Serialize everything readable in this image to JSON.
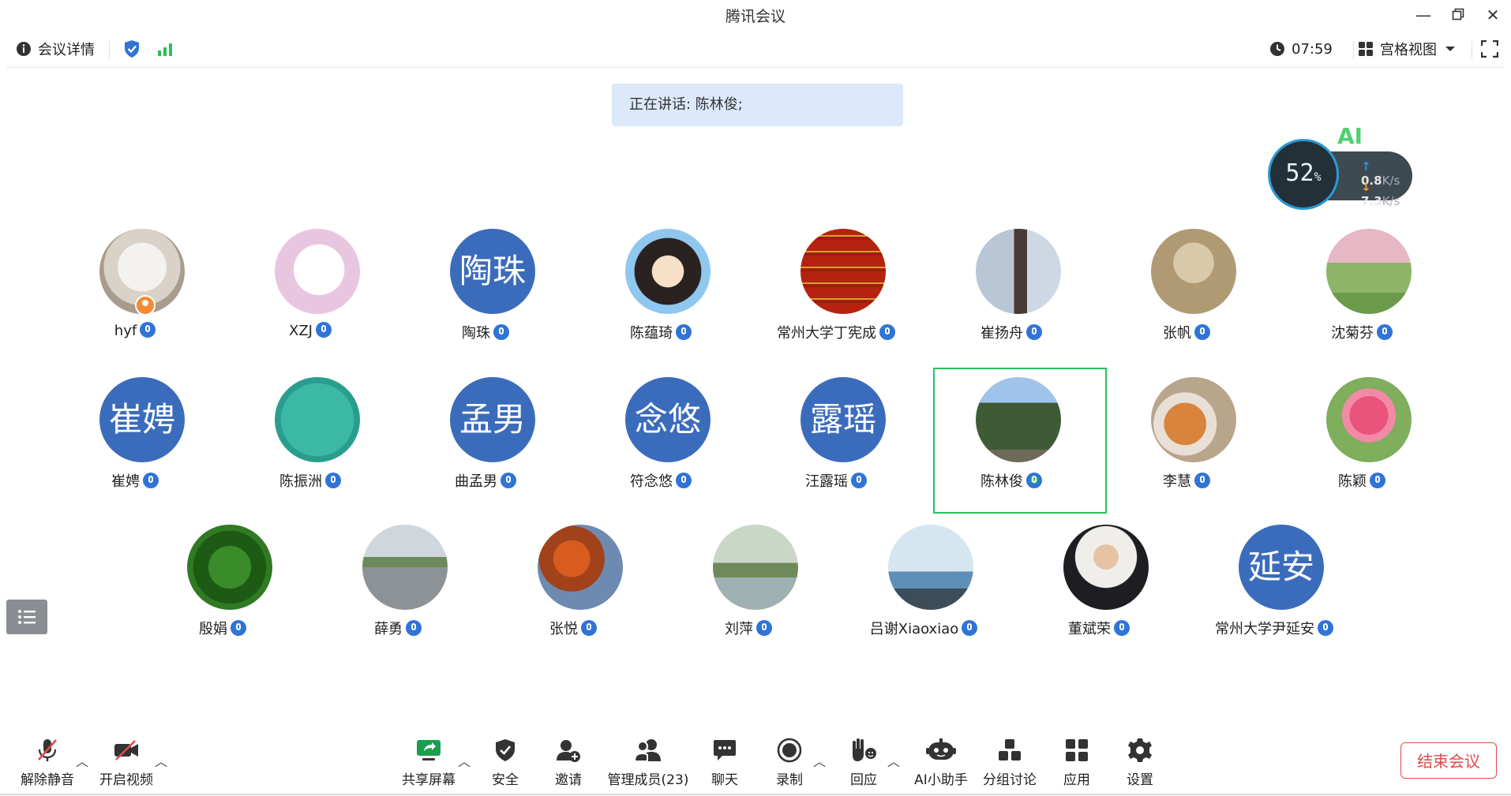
{
  "window": {
    "title": "腾讯会议"
  },
  "topbar": {
    "meeting_info": "会议详情",
    "timer": "07:59",
    "view_mode": "宫格视图"
  },
  "speaking": "正在讲话: 陈林俊;",
  "network": {
    "ai_label": "AI",
    "cpu_percent": "52",
    "percent_sign": "%",
    "up_rate": "0.8",
    "down_rate": "7.3",
    "rate_unit": "K/s"
  },
  "participants": [
    {
      "name": "hyf",
      "avatar_text": "",
      "photo": "cat"
    },
    {
      "name": "XZJ",
      "avatar_text": "",
      "photo": "cartoon-bear"
    },
    {
      "name": "陶珠",
      "avatar_text": "陶珠"
    },
    {
      "name": "陈蕴琦",
      "avatar_text": "",
      "photo": "cartoon-girl"
    },
    {
      "name": "常州大学丁宪成",
      "avatar_text": "",
      "photo": "red-calligraphy"
    },
    {
      "name": "崔扬舟",
      "avatar_text": "",
      "photo": "person-window"
    },
    {
      "name": "张帆",
      "avatar_text": "",
      "photo": "ink-portrait"
    },
    {
      "name": "沈菊芬",
      "avatar_text": "",
      "photo": "blossom-park"
    },
    {
      "name": "崔娉",
      "avatar_text": "崔娉"
    },
    {
      "name": "陈振洲",
      "avatar_text": "",
      "photo": "flower-card"
    },
    {
      "name": "曲孟男",
      "avatar_text": "孟男"
    },
    {
      "name": "符念悠",
      "avatar_text": "念悠"
    },
    {
      "name": "汪露瑶",
      "avatar_text": "露瑶"
    },
    {
      "name": "陈林俊",
      "avatar_text": "",
      "photo": "tree"
    },
    {
      "name": "李慧",
      "avatar_text": "",
      "photo": "shiba-dog"
    },
    {
      "name": "陈颖",
      "avatar_text": "",
      "photo": "pink-peony"
    },
    {
      "name": "殷娟",
      "avatar_text": "",
      "photo": "green-plant"
    },
    {
      "name": "薛勇",
      "avatar_text": "",
      "photo": "road"
    },
    {
      "name": "张悦",
      "avatar_text": "",
      "photo": "autumn-leaves"
    },
    {
      "name": "刘萍",
      "avatar_text": "",
      "photo": "lake-swans"
    },
    {
      "name": "吕谢Xiaoxiao",
      "avatar_text": "",
      "photo": "person-lake"
    },
    {
      "name": "董斌荣",
      "avatar_text": "",
      "photo": "man-portrait"
    },
    {
      "name": "常州大学尹延安",
      "avatar_text": "延安"
    }
  ],
  "toolbar": {
    "unmute": "解除静音",
    "video": "开启视频",
    "share": "共享屏幕",
    "security": "安全",
    "invite": "邀请",
    "members": "管理成员(23)",
    "chat": "聊天",
    "record": "录制",
    "reaction": "回应",
    "ai_assistant": "AI小助手",
    "breakout": "分组讨论",
    "apps": "应用",
    "settings": "设置",
    "end": "结束会议"
  },
  "colors": {
    "accent_blue": "#2f74d6",
    "speaking_green": "#27c25a",
    "end_red": "#e24a4a",
    "avatar_blue": "#3b6cbc"
  }
}
